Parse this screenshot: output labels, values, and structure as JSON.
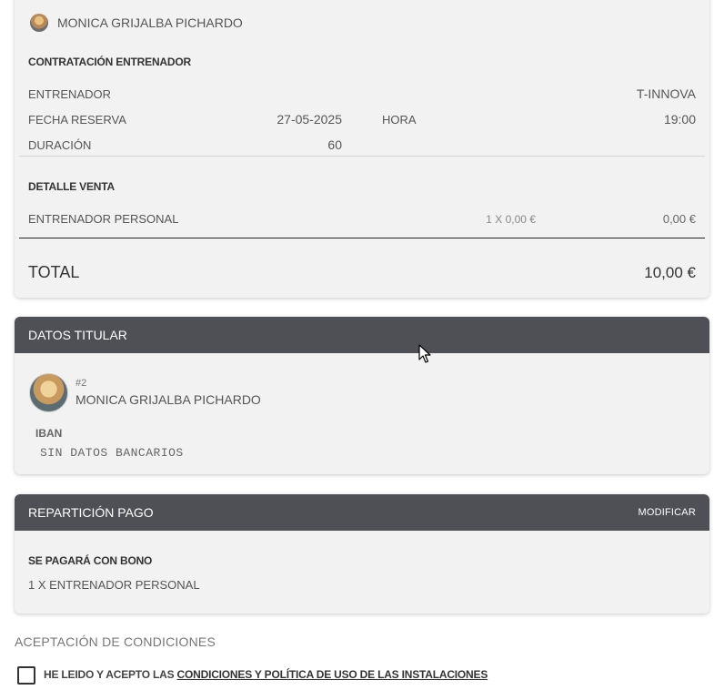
{
  "summary": {
    "user_name": "MONICA GRIJALBA PICHARDO",
    "section_contract_title": "CONTRATACIÓN ENTRENADOR",
    "trainer_label": "ENTRENADOR",
    "trainer_value": "T-INNOVA",
    "date_label": "FECHA RESERVA",
    "date_value": "27-05-2025",
    "time_label": "HORA",
    "time_value": "19:00",
    "duration_label": "DURACIÓN",
    "duration_value": "60",
    "section_sale_title": "DETALLE VENTA",
    "sale_item_label": "ENTRENADOR PERSONAL",
    "sale_item_qty_price": "1 X 0,00 €",
    "sale_item_total": "0,00 €",
    "total_label": "TOTAL",
    "total_value": "10,00 €"
  },
  "holder": {
    "header": "DATOS TITULAR",
    "id": "#2",
    "name": "MONICA GRIJALBA PICHARDO",
    "iban_label": "IBAN",
    "iban_value": "SIN DATOS BANCARIOS"
  },
  "payment": {
    "header": "REPARTICIÓN PAGO",
    "modify_label": "MODIFICAR",
    "pay_title": "SE PAGARÁ CON BONO",
    "pay_item": "1 X ENTRENADOR PERSONAL"
  },
  "conditions": {
    "title": "ACEPTACIÓN DE CONDICIONES",
    "text_prefix": "HE LEIDO Y ACEPTO LAS",
    "link_text": "CONDICIONES Y POLÍTICA DE USO DE LAS INSTALACIONES",
    "checked": false
  },
  "colors": {
    "header_bg": "#4f4f56",
    "card_bg": "#f2f2f2"
  }
}
